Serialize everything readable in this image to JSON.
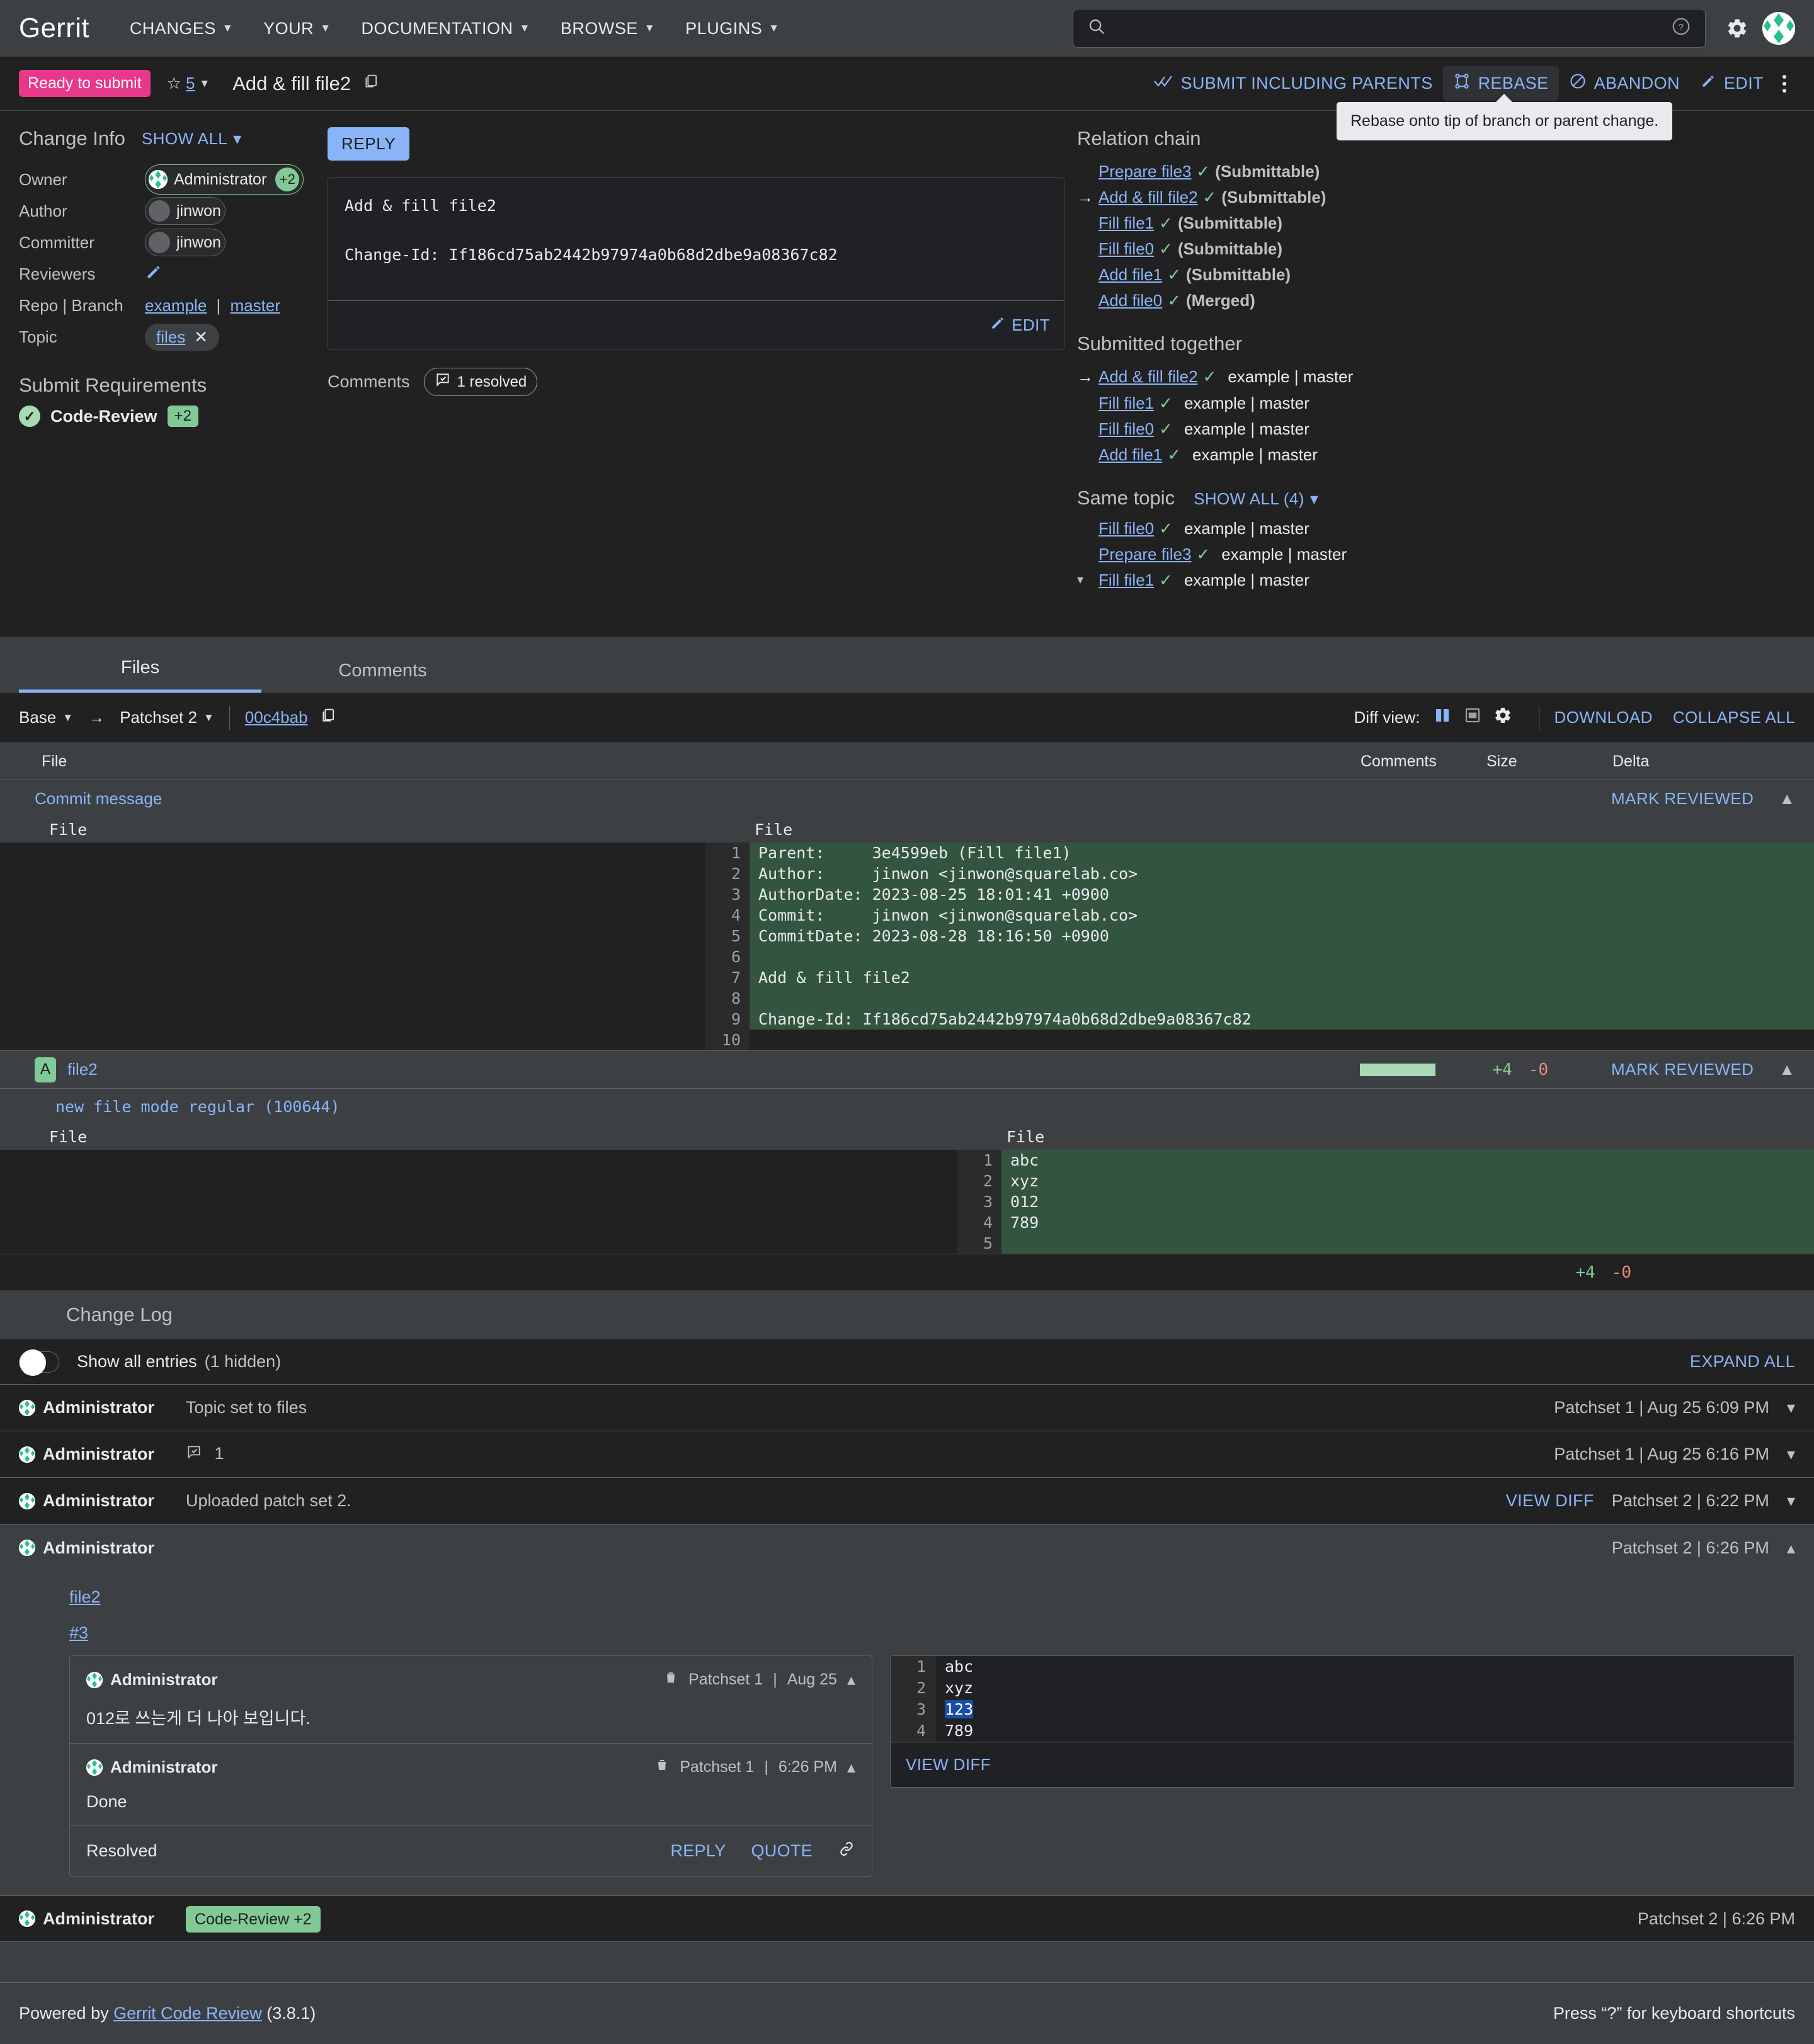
{
  "topnav": {
    "brand": "Gerrit",
    "items": [
      {
        "label": "CHANGES"
      },
      {
        "label": "YOUR"
      },
      {
        "label": "DOCUMENTATION"
      },
      {
        "label": "BROWSE"
      },
      {
        "label": "PLUGINS"
      }
    ],
    "search": {
      "value": "",
      "placeholder": ""
    }
  },
  "changebar": {
    "status": "Ready to submit",
    "star_count": "5",
    "title": "Add & fill file2",
    "actions": [
      {
        "label": "SUBMIT INCLUDING PARENTS"
      },
      {
        "label": "REBASE"
      },
      {
        "label": "ABANDON"
      },
      {
        "label": "EDIT"
      }
    ],
    "tooltip": "Rebase onto tip of branch or parent change."
  },
  "change_info": {
    "title": "Change Info",
    "show_all": "SHOW ALL",
    "rows": [
      {
        "label": "Owner",
        "value": "Administrator",
        "vote": "+2"
      },
      {
        "label": "Author",
        "value": "jinwon"
      },
      {
        "label": "Committer",
        "value": "jinwon"
      },
      {
        "label": "Reviewers",
        "value": ""
      }
    ],
    "repo_label": "Repo | Branch",
    "repo": "example",
    "branch": "master",
    "topic_label": "Topic",
    "topic": "files",
    "requirements_title": "Submit Requirements",
    "requirements": [
      {
        "name": "Code-Review",
        "score": "+2"
      }
    ]
  },
  "message": {
    "reply_label": "REPLY",
    "body": "Add & fill file2\n\nChange-Id: If186cd75ab2442b97974a0b68d2dbe9a08367c82",
    "edit_label": "EDIT",
    "comments_label": "Comments",
    "comments_chip": "1 resolved"
  },
  "relation_chain": {
    "title": "Relation chain",
    "items": [
      {
        "name": "Prepare file3",
        "state": "(Submittable)",
        "current": false
      },
      {
        "name": "Add & fill file2",
        "state": "(Submittable)",
        "current": true
      },
      {
        "name": "Fill file1",
        "state": "(Submittable)",
        "current": false
      },
      {
        "name": "Fill file0",
        "state": "(Submittable)",
        "current": false
      },
      {
        "name": "Add file1",
        "state": "(Submittable)",
        "current": false
      },
      {
        "name": "Add file0",
        "state": "(Merged)",
        "current": false
      }
    ]
  },
  "submitted_together": {
    "title": "Submitted together",
    "items": [
      {
        "name": "Add & fill file2",
        "branch": "example | master",
        "current": true
      },
      {
        "name": "Fill file1",
        "branch": "example | master",
        "current": false
      },
      {
        "name": "Fill file0",
        "branch": "example | master",
        "current": false
      },
      {
        "name": "Add file1",
        "branch": "example | master",
        "current": false
      }
    ]
  },
  "same_topic": {
    "title": "Same topic",
    "show_all": "SHOW ALL (4)",
    "items": [
      {
        "name": "Fill file0",
        "branch": "example | master",
        "expandable": false
      },
      {
        "name": "Prepare file3",
        "branch": "example | master",
        "expandable": false
      },
      {
        "name": "Fill file1",
        "branch": "example | master",
        "expandable": true
      }
    ]
  },
  "tabs": [
    {
      "label": "Files",
      "active": true
    },
    {
      "label": "Comments",
      "active": false
    }
  ],
  "files_toolbar": {
    "base": "Base",
    "patchset": "Patchset 2",
    "sha": "00c4bab",
    "diff_view_label": "Diff view:",
    "download": "DOWNLOAD",
    "collapse_all": "COLLAPSE ALL"
  },
  "files_header": {
    "file": "File",
    "comments": "Comments",
    "size": "Size",
    "delta": "Delta"
  },
  "files": [
    {
      "name": "Commit message",
      "badge": "",
      "mark_reviewed": "MARK REVIEWED",
      "show_stats": false,
      "plus": "",
      "minus": "",
      "gutter_left": "File",
      "gutter_right": "File",
      "mode_line": "",
      "lines": [
        {
          "n": "1",
          "text": "Parent:     3e4599eb (Fill file1)"
        },
        {
          "n": "2",
          "text": "Author:     jinwon <jinwon@squarelab.co>"
        },
        {
          "n": "3",
          "text": "AuthorDate: 2023-08-25 18:01:41 +0900"
        },
        {
          "n": "4",
          "text": "Commit:     jinwon <jinwon@squarelab.co>"
        },
        {
          "n": "5",
          "text": "CommitDate: 2023-08-28 18:16:50 +0900"
        },
        {
          "n": "6",
          "text": ""
        },
        {
          "n": "7",
          "text": "Add & fill file2"
        },
        {
          "n": "8",
          "text": ""
        },
        {
          "n": "9",
          "text": "Change-Id: If186cd75ab2442b97974a0b68d2dbe9a08367c82"
        },
        {
          "n": "10",
          "text": ""
        }
      ]
    },
    {
      "name": "file2",
      "badge": "A",
      "mark_reviewed": "MARK REVIEWED",
      "show_stats": true,
      "plus": "+4",
      "minus": "-0",
      "gutter_left": "File",
      "gutter_right": "File",
      "mode_line": "new file mode regular (100644)",
      "lines": [
        {
          "n": "1",
          "text": "abc"
        },
        {
          "n": "2",
          "text": "xyz"
        },
        {
          "n": "3",
          "text": "012"
        },
        {
          "n": "4",
          "text": "789"
        },
        {
          "n": "5",
          "text": ""
        }
      ]
    }
  ],
  "file2_footer": {
    "plus": "+4",
    "minus": "-0"
  },
  "change_log": {
    "title": "Change Log",
    "show_all_label": "Show all entries",
    "hidden_label": "(1 hidden)",
    "expand_all": "EXPAND ALL",
    "entries": [
      {
        "who": "Administrator",
        "message": "Topic set to files",
        "right": "Patchset 1 | Aug 25 6:09 PM",
        "viewdiff": "",
        "chev": "⌄",
        "active": false,
        "comment_count": ""
      },
      {
        "who": "Administrator",
        "message": "",
        "right": "Patchset 1 | Aug 25 6:16 PM",
        "viewdiff": "",
        "chev": "⌄",
        "active": false,
        "comment_count": "1"
      },
      {
        "who": "Administrator",
        "message": "Uploaded patch set 2.",
        "right": "Patchset 2 | 6:22 PM",
        "viewdiff": "VIEW DIFF",
        "chev": "⌄",
        "active": false,
        "comment_count": ""
      },
      {
        "who": "Administrator",
        "message": "",
        "right": "Patchset 2 | 6:26 PM",
        "viewdiff": "",
        "chev": "⌃",
        "active": true,
        "comment_count": ""
      }
    ],
    "expanded": {
      "file_link": "file2",
      "line_link": "#3",
      "comments": [
        {
          "who": "Administrator",
          "patchset": "Patchset 1",
          "time": "Aug 25",
          "body": "012로 쓰는게 더 나아 보입니다."
        },
        {
          "who": "Administrator",
          "patchset": "Patchset 1",
          "time": "6:26 PM",
          "body": "Done"
        }
      ],
      "resolved_label": "Resolved",
      "actions": [
        "REPLY",
        "QUOTE"
      ],
      "snippet_lines": [
        {
          "n": "1",
          "text": "abc",
          "highlight": false
        },
        {
          "n": "2",
          "text": "xyz",
          "highlight": false
        },
        {
          "n": "3",
          "text": "123",
          "highlight": true
        },
        {
          "n": "4",
          "text": "789",
          "highlight": false
        }
      ],
      "view_diff": "VIEW DIFF"
    },
    "final_row": {
      "who": "Administrator",
      "label": "Code-Review +2",
      "right": "Patchset 2 | 6:26 PM"
    }
  },
  "footer": {
    "powered_by": "Powered by",
    "link": "Gerrit Code Review",
    "version": "(3.8.1)",
    "shortcut": "Press “?” for keyboard shortcuts"
  }
}
